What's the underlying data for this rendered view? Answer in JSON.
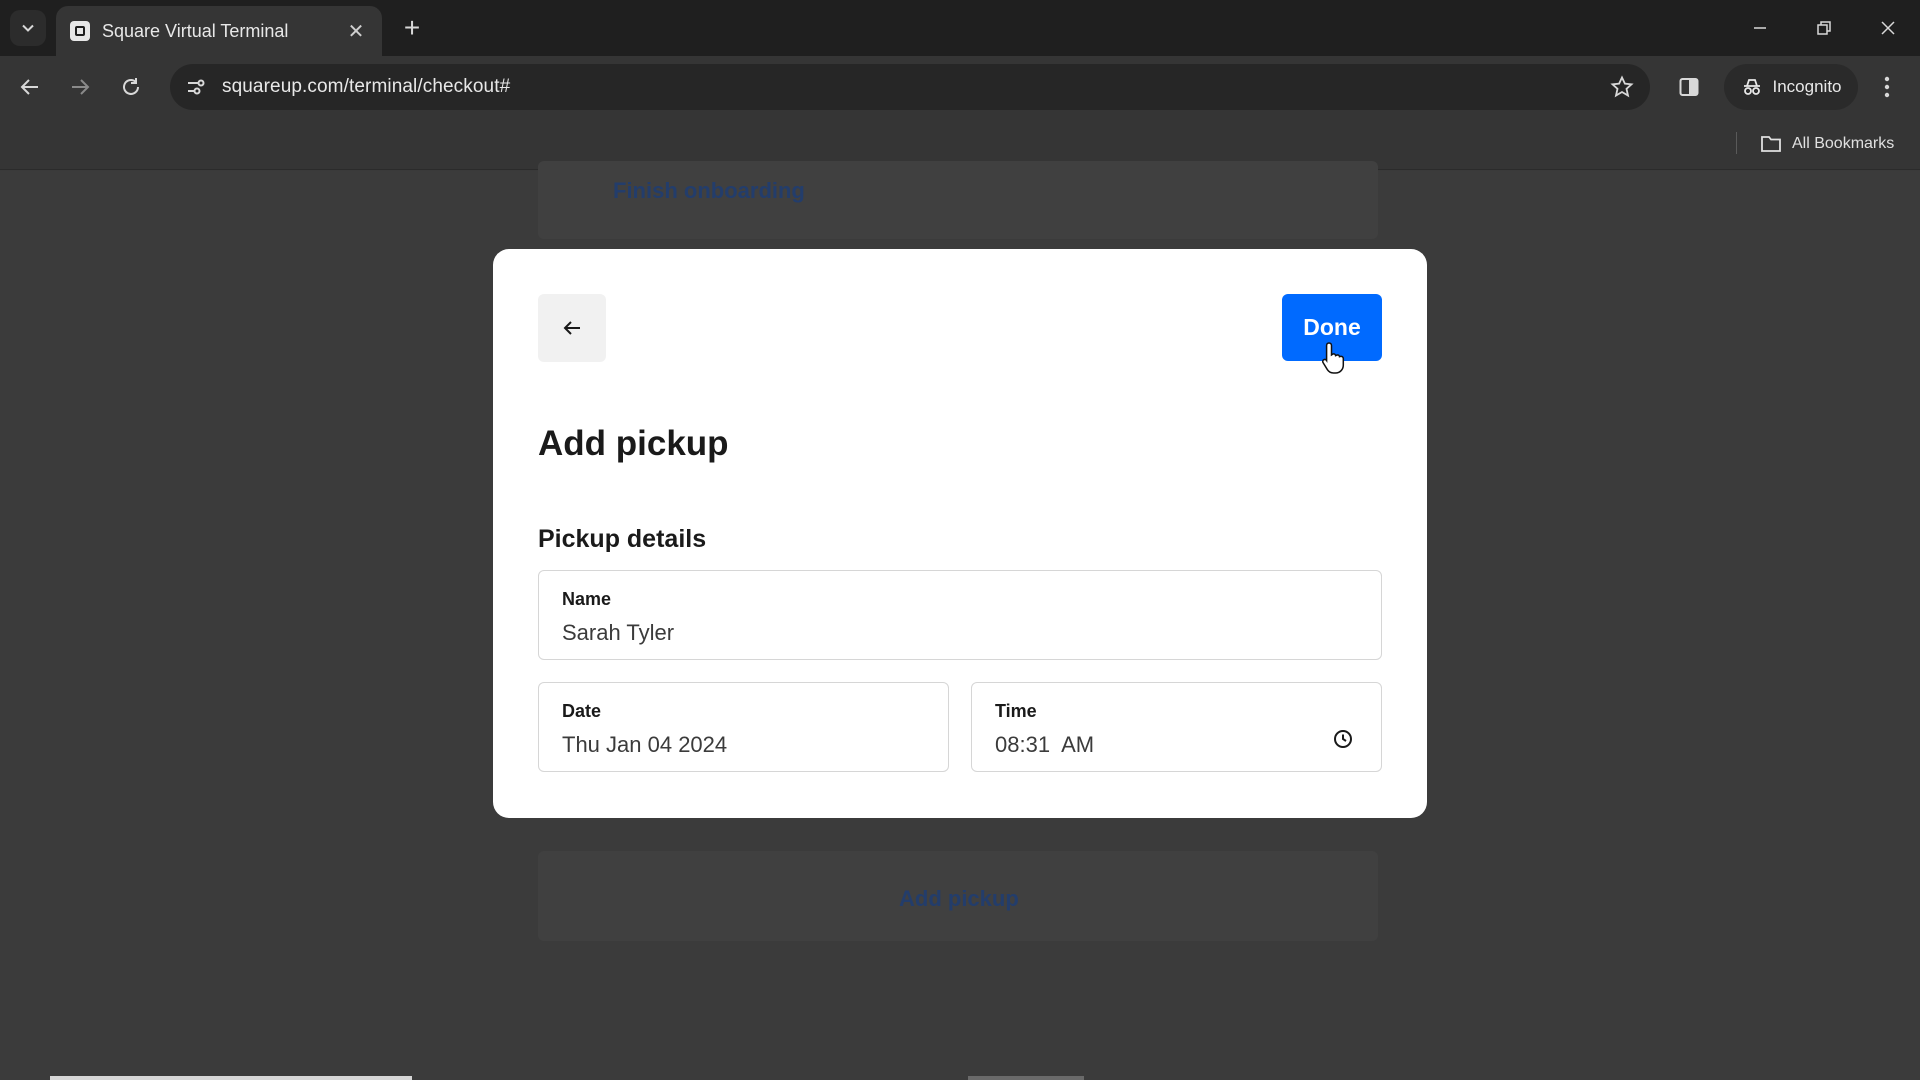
{
  "browser": {
    "tab_title": "Square Virtual Terminal",
    "url": "squareup.com/terminal/checkout#",
    "incognito_label": "Incognito",
    "bookmarks_label": "All Bookmarks"
  },
  "background": {
    "top_link": "Finish onboarding",
    "bottom_link": "Add pickup"
  },
  "modal": {
    "title": "Add pickup",
    "done_label": "Done",
    "section_title": "Pickup details",
    "fields": {
      "name": {
        "label": "Name",
        "value": "Sarah Tyler"
      },
      "date": {
        "label": "Date",
        "value": "Thu Jan 04 2024"
      },
      "time": {
        "label": "Time",
        "value": "08:31  AM"
      }
    }
  },
  "colors": {
    "primary": "#006aff",
    "link_dim": "#233d6b"
  }
}
